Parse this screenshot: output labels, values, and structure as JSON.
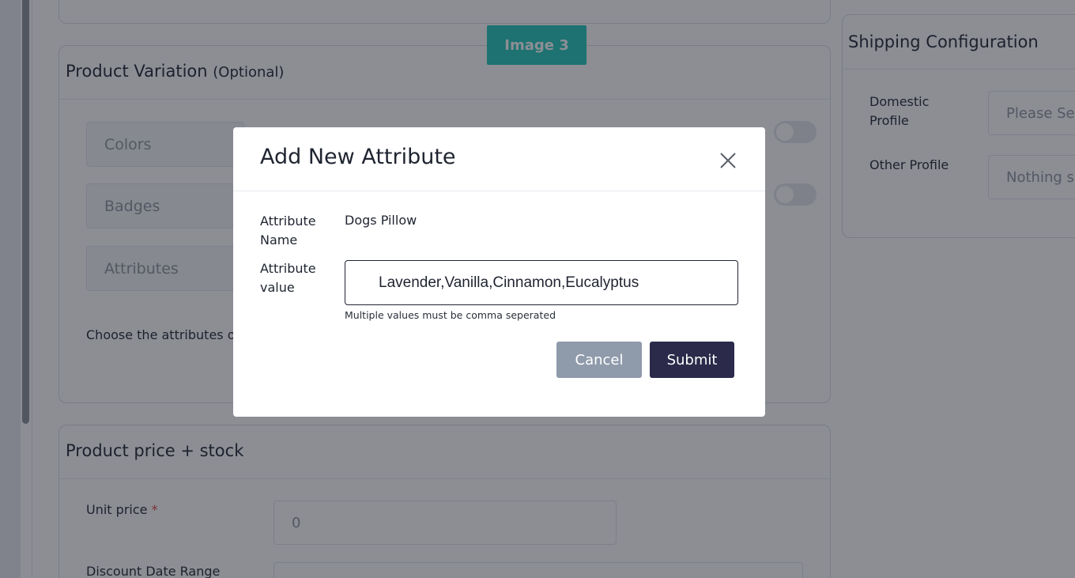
{
  "background": {
    "image_badge": "Image 3",
    "product_variation": {
      "title": "Product Variation",
      "title_suffix": "(Optional)",
      "rows": [
        "Colors",
        "Badges",
        "Attributes"
      ],
      "note": "Choose the attributes o"
    },
    "shipping": {
      "title": "Shipping Configuration",
      "domestic_label": "Domestic Profile",
      "domestic_placeholder": "Please Se",
      "other_label": "Other Profile",
      "other_placeholder": "Nothing s"
    },
    "price_stock": {
      "title": "Product price + stock",
      "unit_price_label": "Unit price",
      "unit_price_required": "*",
      "unit_price_value": "0",
      "discount_label": "Discount Date Range"
    }
  },
  "modal": {
    "title": "Add New Attribute",
    "name_label": "Attribute Name",
    "name_value": "Dogs Pillow",
    "value_label": "Attribute value",
    "value_input": "Lavender,Vanilla,Cinnamon,Eucalyptus",
    "help_text": "Multiple values must be comma seperated",
    "cancel_label": "Cancel",
    "submit_label": "Submit",
    "close_icon": "close-icon"
  },
  "colors": {
    "badge": "#22c7b8",
    "submit": "#2b2a4a",
    "cancel": "#8f9aab",
    "overlay": "rgba(26,30,42,0.5)"
  }
}
